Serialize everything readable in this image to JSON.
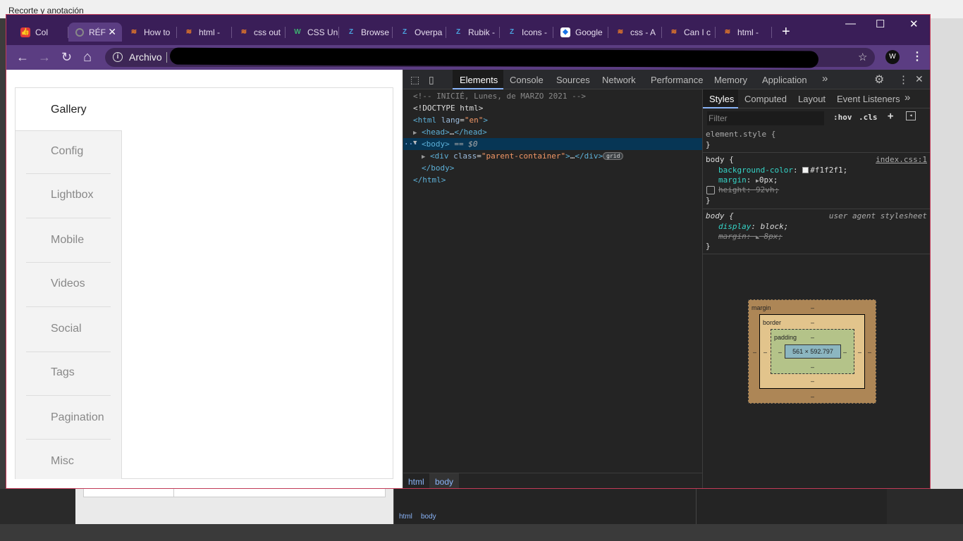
{
  "background": {
    "app_title": "Recorte y anotación",
    "devtools_crumbs": [
      "html",
      "body"
    ]
  },
  "browser": {
    "tabs": [
      {
        "title": "Col",
        "icon": "thumbs-up-icon"
      },
      {
        "title": "RÉF",
        "icon": "loading-icon",
        "active": true
      },
      {
        "title": "How to",
        "icon": "stackoverflow-icon"
      },
      {
        "title": "html -",
        "icon": "stackoverflow-icon"
      },
      {
        "title": "css out",
        "icon": "stackoverflow-icon"
      },
      {
        "title": "CSS Un",
        "icon": "w3-icon"
      },
      {
        "title": "Browse",
        "icon": "site-icon"
      },
      {
        "title": "Overpa",
        "icon": "site-icon"
      },
      {
        "title": "Rubik -",
        "icon": "site-icon"
      },
      {
        "title": "Icons -",
        "icon": "site-icon"
      },
      {
        "title": "Google",
        "icon": "google-fonts-icon"
      },
      {
        "title": "css - A",
        "icon": "stackoverflow-icon"
      },
      {
        "title": "Can I c",
        "icon": "stackoverflow-icon"
      },
      {
        "title": "html -",
        "icon": "stackoverflow-icon"
      }
    ],
    "new_tab": "+",
    "window_controls": {
      "minimize": "—",
      "maximize": "☐",
      "close": "✕"
    },
    "nav": {
      "back": "←",
      "forward": "→",
      "reload": "↻",
      "home": "⌂"
    },
    "address": {
      "security_label": "Archivo",
      "security_icon": "i",
      "bookmark": "☆"
    },
    "extension_label": "W",
    "menu": "⋮"
  },
  "page": {
    "gallery_title": "Gallery",
    "sidebar_items": [
      "Config",
      "Lightbox",
      "Mobile",
      "Videos",
      "Social",
      "Tags",
      "Pagination",
      "Misc"
    ]
  },
  "devtools": {
    "tabs": [
      "Elements",
      "Console",
      "Sources",
      "Network",
      "Performance",
      "Memory",
      "Application"
    ],
    "more_tabs": "»",
    "settings": "⚙",
    "menu": "⋮",
    "close": "✕",
    "dom": {
      "comment": "<!-- INICIÉ, Lunes, de MARZO 2021 -->",
      "doctype": "<!DOCTYPE html>",
      "html_open_tag": "<html",
      "html_lang_attr": "lang",
      "html_lang_value": "\"en\"",
      "head_open": "<head>",
      "head_close": "</head>",
      "ellipsis": "…",
      "body_open": "<body>",
      "selected_marker": "== $0",
      "selection_dots": "···",
      "div_open_tag": "<div",
      "div_class_attr": "class",
      "div_class_value": "\"parent-container\"",
      "div_close": "</div>",
      "grid_badge": "grid",
      "body_close": "</body>",
      "html_close": "</html>"
    },
    "breadcrumbs": [
      "html",
      "body"
    ],
    "styles": {
      "tabs": [
        "Styles",
        "Computed",
        "Layout",
        "Event Listeners"
      ],
      "more": "»",
      "filter_placeholder": "Filter",
      "hov": ":hov",
      "cls": ".cls",
      "add": "+",
      "element_style": "element.style {",
      "close_brace": "}",
      "body_rule": {
        "selector": "body",
        "open": "{",
        "source": "index.css:1",
        "declarations": [
          {
            "prop": "background-color",
            "value": "#f1f2f1;",
            "swatch": "#f1f2f1"
          },
          {
            "prop": "margin",
            "value": "0px;"
          },
          {
            "prop": "height",
            "value": "92vh;",
            "disabled": true
          }
        ]
      },
      "ua_rule": {
        "selector": "body",
        "open": "{",
        "source": "user agent stylesheet",
        "declarations": [
          {
            "prop": "display",
            "value": "block;"
          },
          {
            "prop": "margin",
            "value": "8px;",
            "overridden": true
          }
        ]
      },
      "box_model": {
        "margin_label": "margin",
        "border_label": "border",
        "padding_label": "padding",
        "dash": "–",
        "content_size": "561 × 592.797"
      }
    }
  }
}
